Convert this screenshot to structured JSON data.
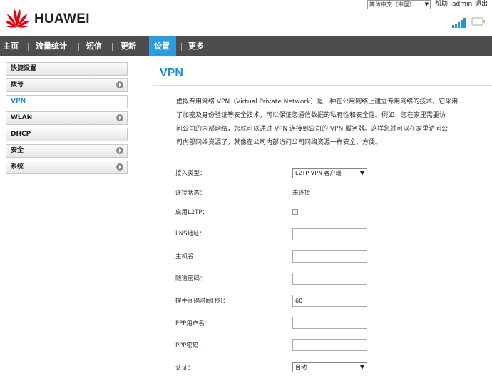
{
  "brand": {
    "name": "HUAWEI",
    "logo_color": "#e60012"
  },
  "top_bar": {
    "language": "简体中文（中国）",
    "help": "帮助",
    "user": "admin",
    "logout": "退出"
  },
  "nav": {
    "items": [
      {
        "label": "主页"
      },
      {
        "label": "流量统计"
      },
      {
        "label": "短信"
      },
      {
        "label": "更新"
      },
      {
        "label": "设置",
        "active": true
      },
      {
        "label": "更多"
      }
    ]
  },
  "sidebar": {
    "items": [
      {
        "label": "快捷设置",
        "has_arrow": false
      },
      {
        "label": "拨号",
        "has_arrow": true
      },
      {
        "label": "VPN",
        "has_arrow": false,
        "active": true
      },
      {
        "label": "WLAN",
        "has_arrow": true
      },
      {
        "label": "DHCP",
        "has_arrow": false
      },
      {
        "label": "安全",
        "has_arrow": true
      },
      {
        "label": "系统",
        "has_arrow": true
      }
    ]
  },
  "main": {
    "title": "VPN",
    "intro_lines": [
      "虚拟专用网络 VPN（Virtual Private Network）是一种在公用网络上建立专用网络的技术。它采用",
      "了加密及身份验证等安全技术，可以保证您通信数据的私有性和安全性。例如：您在家里需要访",
      "问公司的内部网络，您就可以通过 VPN 连接到公司的 VPN 服务器。这样您就可以在家里访问公",
      "司内部网络资源了，就像在公司内部访问公司网络资源一样安全、方便。"
    ],
    "form": {
      "access_type_label": "接入类型：",
      "access_type_value": "L2TP VPN 客户端",
      "status_label": "连接状态：",
      "status_value": "未连接",
      "enable_l2tp_label": "启用L2TP：",
      "enable_l2tp_checked": false,
      "lns_label": "LNS地址：",
      "lns_value": "",
      "hostname_label": "主机名：",
      "hostname_value": "",
      "tunnel_pwd_label": "隧道密码：",
      "tunnel_pwd_value": "",
      "hello_label": "握手间隔时间(秒)：",
      "hello_value": "60",
      "ppp_user_label": "PPP用户名：",
      "ppp_user_value": "",
      "ppp_pwd_label": "PPP密码：",
      "ppp_pwd_value": "",
      "auth_label": "认证：",
      "auth_value": "自动"
    }
  },
  "colors": {
    "accent": "#2b9adf",
    "title": "#1e8dd8",
    "nav_bg": "#4d4d4d"
  }
}
